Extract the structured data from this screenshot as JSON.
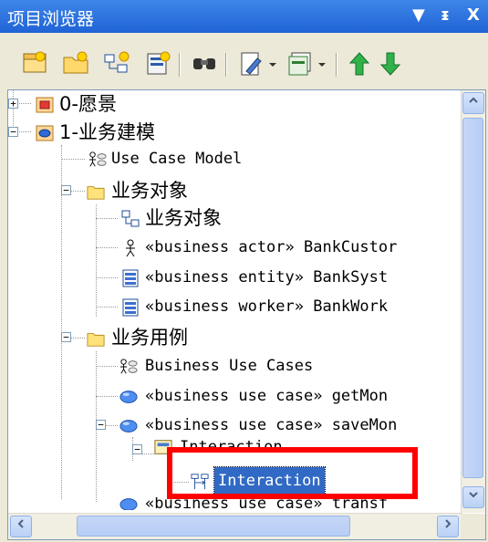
{
  "window": {
    "title": "项目浏览器",
    "controls": [
      "▼",
      "ᵻ",
      "X"
    ]
  },
  "toolbar": {
    "buttons": [
      {
        "icon": "new-package-icon"
      },
      {
        "icon": "new-folder-icon"
      },
      {
        "icon": "new-diagram-icon"
      },
      {
        "icon": "new-element-icon"
      },
      {
        "icon": "find-icon"
      },
      {
        "icon": "edit-icon"
      },
      {
        "icon": "view-icon"
      },
      {
        "icon": "move-up-icon"
      },
      {
        "icon": "move-down-icon"
      }
    ]
  },
  "tree": {
    "items": [
      {
        "label": "0-愿景"
      },
      {
        "label": "1-业务建模"
      },
      {
        "label": "Use Case Model"
      },
      {
        "label": "业务对象"
      },
      {
        "label": "业务对象"
      },
      {
        "label": "«business actor» BankCustor"
      },
      {
        "label": "«business entity» BankSyst"
      },
      {
        "label": "«business worker» BankWork"
      },
      {
        "label": "业务用例"
      },
      {
        "label": "Business Use Cases"
      },
      {
        "label": "«business use case» getMon"
      },
      {
        "label": "«business use case» saveMon"
      },
      {
        "label": "Interaction"
      },
      {
        "label": "Interaction"
      },
      {
        "label": "«business use case» transf"
      }
    ]
  },
  "colors": {
    "title_bar": "#2b6fdc",
    "selection": "#316ac5",
    "highlight_box": "#ff0000"
  }
}
